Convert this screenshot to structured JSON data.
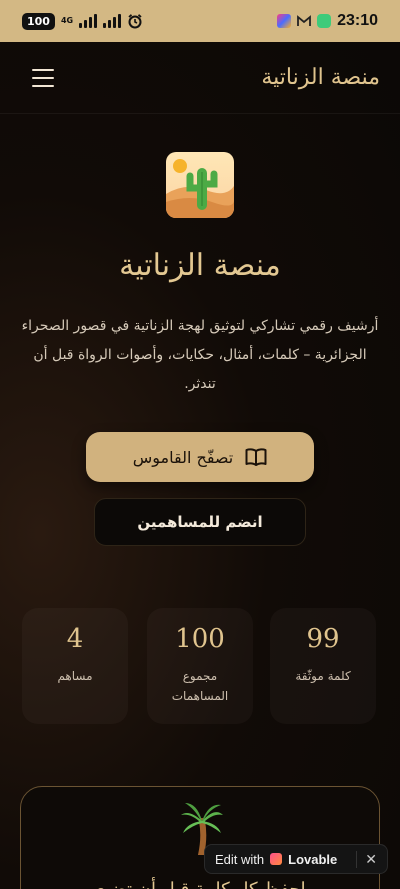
{
  "status_bar": {
    "battery": "100",
    "network": "4G",
    "time": "23:10"
  },
  "nav": {
    "brand": "منصة الزناتية"
  },
  "hero": {
    "title": "منصة الزناتية",
    "description": "أرشيف رقمي تشاركي لتوثيق لهجة الزناتية في قصور الصحراء الجزائرية – كلمات، أمثال، حكايات، وأصوات الرواة قبل أن تندثر.",
    "primary_button": "تصفّح القاموس",
    "secondary_button": "انضم للمساهمين"
  },
  "stats": [
    {
      "value": "99",
      "label": "كلمة موثّقة"
    },
    {
      "value": "100",
      "label": "مجموع المساهمات"
    },
    {
      "value": "4",
      "label": "مساهم"
    }
  ],
  "bottom_card": {
    "text": "احفظ كل كلمة قبل أن تضيع"
  },
  "lovable_badge": {
    "prefix": "Edit with",
    "name": "Lovable",
    "close": "✕"
  },
  "colors": {
    "accent": "#d1b27e",
    "gold_text": "#e0c48e",
    "status_bar": "#d3b884",
    "background": "#0b0806"
  }
}
